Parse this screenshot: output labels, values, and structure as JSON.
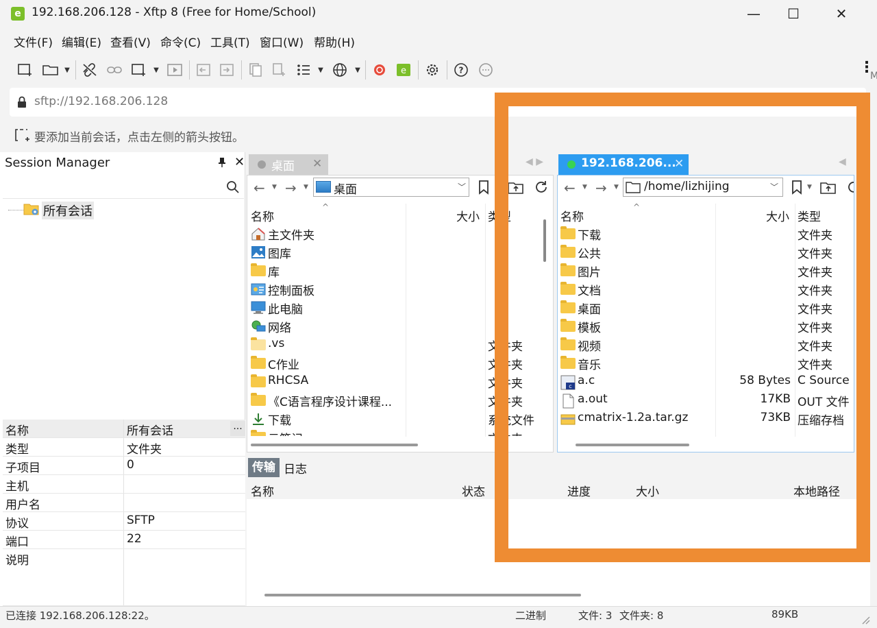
{
  "window": {
    "title": "192.168.206.128 - Xftp 8 (Free for Home/School)",
    "app_icon_glyph": "e",
    "minimize": "—",
    "maximize": "☐",
    "close": "✕"
  },
  "menu": [
    "文件(F)",
    "编辑(E)",
    "查看(V)",
    "命令(C)",
    "工具(T)",
    "窗口(W)",
    "帮助(H)"
  ],
  "toolbar": {
    "icons": [
      "new-session-icon",
      "open-folder-icon",
      "disconnect-icon",
      "link-icon",
      "new-window-icon",
      "play-icon",
      "transfer-left-icon",
      "transfer-right-icon",
      "copy-icon",
      "paste-icon",
      "list-view-icon",
      "globe-icon",
      "snail-icon",
      "xftp-icon",
      "gear-icon",
      "help-icon",
      "chat-icon"
    ],
    "overflow": "⋮",
    "edge_fragment": "M"
  },
  "address": {
    "value": "sftp://192.168.206.128"
  },
  "hint": {
    "text": "要添加当前会话，点击左侧的箭头按钮。"
  },
  "session_manager": {
    "title": "Session Manager",
    "pin": "📌",
    "close": "✕",
    "tree": [
      {
        "label": "所有会话"
      }
    ],
    "properties": [
      {
        "key": "名称",
        "value": "所有会话"
      },
      {
        "key": "类型",
        "value": "文件夹"
      },
      {
        "key": "子项目",
        "value": "0"
      },
      {
        "key": "主机",
        "value": ""
      },
      {
        "key": "用户名",
        "value": ""
      },
      {
        "key": "协议",
        "value": "SFTP"
      },
      {
        "key": "端口",
        "value": "22"
      },
      {
        "key": "说明",
        "value": ""
      }
    ],
    "more_button": "..."
  },
  "local": {
    "tab_label": "桌面",
    "tab_close": "✕",
    "path": "桌面",
    "columns": {
      "name": "名称",
      "size": "大小",
      "type": "类型"
    },
    "files": [
      {
        "name": "主文件夹",
        "icon": "home-icon",
        "type": ""
      },
      {
        "name": "图库",
        "icon": "gallery-icon",
        "type": ""
      },
      {
        "name": "库",
        "icon": "folder-icon",
        "type": ""
      },
      {
        "name": "控制面板",
        "icon": "control-panel-icon",
        "type": ""
      },
      {
        "name": "此电脑",
        "icon": "computer-icon",
        "type": ""
      },
      {
        "name": "网络",
        "icon": "network-icon",
        "type": ""
      },
      {
        "name": ".vs",
        "icon": "folder-light-icon",
        "type": "文件夹"
      },
      {
        "name": "C作业",
        "icon": "folder-icon",
        "type": "文件夹"
      },
      {
        "name": "RHCSA",
        "icon": "folder-icon",
        "type": "文件夹"
      },
      {
        "name": "《C语言程序设计课程...",
        "icon": "folder-icon",
        "type": "文件夹"
      },
      {
        "name": "下载",
        "icon": "download-icon",
        "type": "系统文件"
      },
      {
        "name": "云笔记",
        "icon": "folder-icon",
        "type": "文件夹"
      }
    ]
  },
  "remote": {
    "tab_label": "192.168.206...",
    "tab_close": "✕",
    "path": "/home/lizhijing",
    "columns": {
      "name": "名称",
      "size": "大小",
      "type": "类型"
    },
    "files": [
      {
        "name": "下载",
        "icon": "folder-icon",
        "size": "",
        "type": "文件夹"
      },
      {
        "name": "公共",
        "icon": "folder-icon",
        "size": "",
        "type": "文件夹"
      },
      {
        "name": "图片",
        "icon": "folder-icon",
        "size": "",
        "type": "文件夹"
      },
      {
        "name": "文档",
        "icon": "folder-icon",
        "size": "",
        "type": "文件夹"
      },
      {
        "name": "桌面",
        "icon": "folder-icon",
        "size": "",
        "type": "文件夹"
      },
      {
        "name": "模板",
        "icon": "folder-icon",
        "size": "",
        "type": "文件夹"
      },
      {
        "name": "视频",
        "icon": "folder-icon",
        "size": "",
        "type": "文件夹"
      },
      {
        "name": "音乐",
        "icon": "folder-icon",
        "size": "",
        "type": "文件夹"
      },
      {
        "name": "a.c",
        "icon": "c-source-icon",
        "size": "58 Bytes",
        "type": "C Source"
      },
      {
        "name": "a.out",
        "icon": "file-icon",
        "size": "17KB",
        "type": "OUT 文件"
      },
      {
        "name": "cmatrix-1.2a.tar.gz",
        "icon": "archive-icon",
        "size": "73KB",
        "type": "压缩存档"
      }
    ]
  },
  "transfer": {
    "tabs": [
      "传输",
      "日志"
    ],
    "columns": [
      "名称",
      "状态",
      "进度",
      "大小",
      "本地路径"
    ]
  },
  "status": {
    "connection": "已连接 192.168.206.128:22。",
    "mode": "二进制",
    "files": "文件: 3",
    "folders": "文件夹: 8",
    "size": "89KB"
  },
  "colors": {
    "highlight": "#ee8c33",
    "active_tab": "#2d9cf0",
    "connected_dot": "#39d353",
    "folder": "#f7c948"
  }
}
